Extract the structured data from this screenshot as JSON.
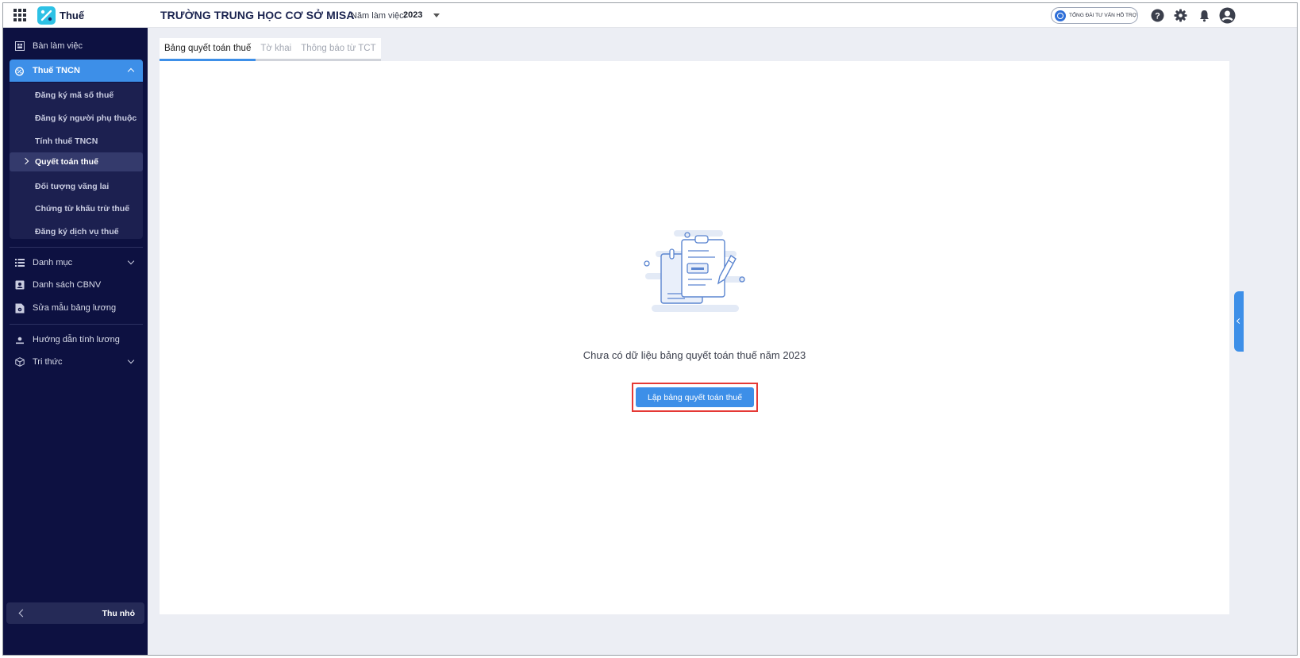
{
  "app": {
    "name": "Thuế"
  },
  "header": {
    "school_name": "TRƯỜNG TRUNG HỌC CƠ SỞ MISA",
    "year_label": "Năm làm việc:",
    "year_value": "2023",
    "support_label": "TỔNG ĐÀI TƯ VẤN HỖ TRỢ",
    "icons": [
      "apps-grid-icon",
      "help-icon",
      "settings-icon",
      "bell-icon",
      "account-icon"
    ]
  },
  "sidebar": {
    "items": [
      {
        "label": "Bàn làm việc",
        "icon": "desk-icon"
      },
      {
        "label": "Thuế TNCN",
        "icon": "tax-icon",
        "active": true
      }
    ],
    "submenu": [
      {
        "label": "Đăng ký mã số thuế"
      },
      {
        "label": "Đăng ký người phụ thuộc"
      },
      {
        "label": "Tính thuế TNCN"
      },
      {
        "label": "Quyết toán thuế",
        "active": true
      },
      {
        "label": "Đối tượng vãng lai"
      },
      {
        "label": "Chứng từ khấu trừ thuế"
      },
      {
        "label": "Đăng ký dịch vụ thuế"
      }
    ],
    "items2": [
      {
        "label": "Danh mục",
        "icon": "list-icon"
      },
      {
        "label": "Danh sách CBNV",
        "icon": "contact-card-icon"
      },
      {
        "label": "Sửa mẫu bảng lương",
        "icon": "settings-document-icon"
      }
    ],
    "items3": [
      {
        "label": "Hướng dẫn tính lương",
        "icon": "guide-icon"
      },
      {
        "label": "Tri thức",
        "icon": "cube-icon"
      }
    ],
    "collapse_label": "Thu nhỏ"
  },
  "tabs": [
    {
      "label": "Bảng quyết toán thuế",
      "active": true
    },
    {
      "label": "Tờ khai"
    },
    {
      "label": "Thông báo từ TCT"
    }
  ],
  "main": {
    "empty_message": "Chưa có dữ liệu bảng quyết toán thuế năm 2023",
    "create_button": "Lập bảng quyết toán thuế"
  },
  "colors": {
    "sidebar_bg": "#0d1141",
    "accent": "#3d8fe8",
    "highlight": "#e53935"
  }
}
